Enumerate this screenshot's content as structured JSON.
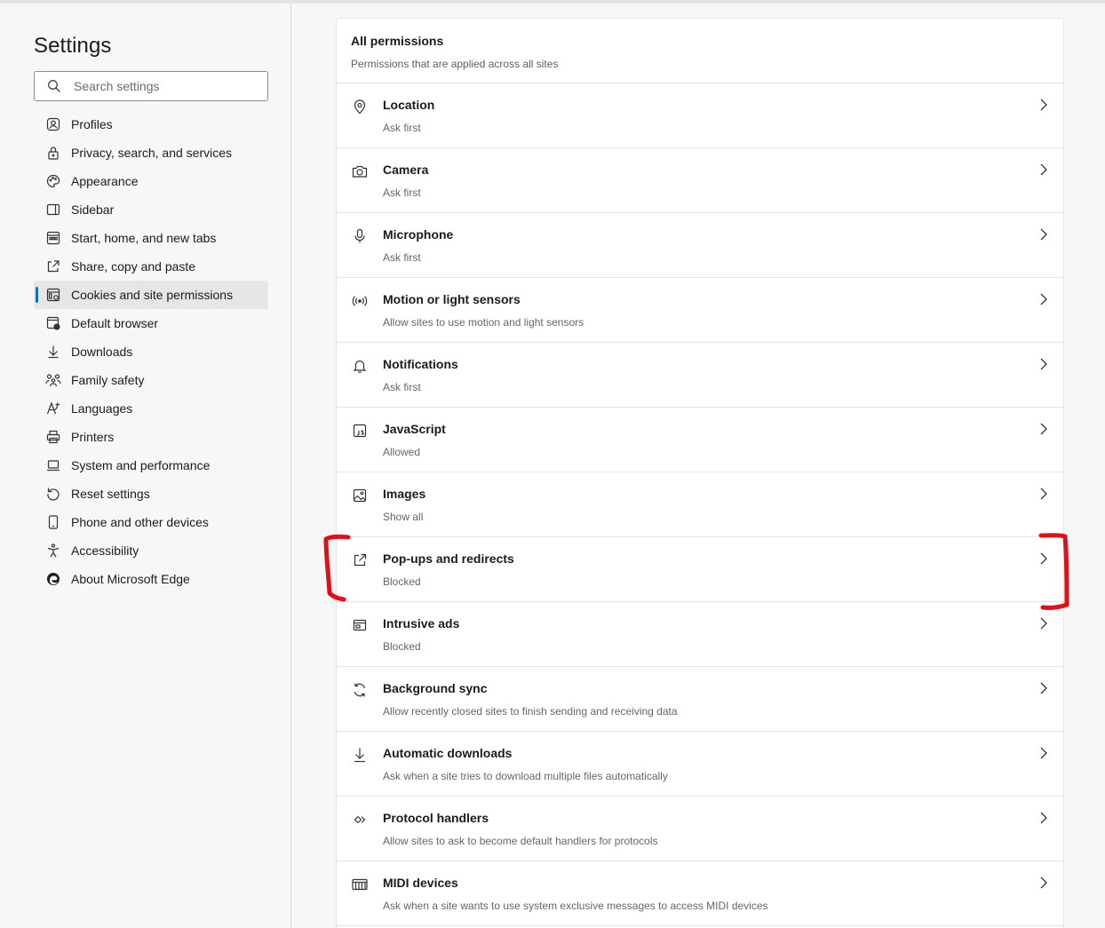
{
  "sidebar": {
    "title": "Settings",
    "search_placeholder": "Search settings",
    "items": [
      {
        "label": "Profiles"
      },
      {
        "label": "Privacy, search, and services"
      },
      {
        "label": "Appearance"
      },
      {
        "label": "Sidebar"
      },
      {
        "label": "Start, home, and new tabs"
      },
      {
        "label": "Share, copy and paste"
      },
      {
        "label": "Cookies and site permissions"
      },
      {
        "label": "Default browser"
      },
      {
        "label": "Downloads"
      },
      {
        "label": "Family safety"
      },
      {
        "label": "Languages"
      },
      {
        "label": "Printers"
      },
      {
        "label": "System and performance"
      },
      {
        "label": "Reset settings"
      },
      {
        "label": "Phone and other devices"
      },
      {
        "label": "Accessibility"
      },
      {
        "label": "About Microsoft Edge"
      }
    ],
    "active_item": "Cookies and site permissions",
    "accent_color": "#0f6cbd"
  },
  "permissions": {
    "title": "All permissions",
    "subtitle": "Permissions that are applied across all sites",
    "items": [
      {
        "title": "Location",
        "status": "Ask first",
        "icon": "location-pin-icon"
      },
      {
        "title": "Camera",
        "status": "Ask first",
        "icon": "camera-icon"
      },
      {
        "title": "Microphone",
        "status": "Ask first",
        "icon": "microphone-icon"
      },
      {
        "title": "Motion or light sensors",
        "status": "Allow sites to use motion and light sensors",
        "icon": "sensor-icon"
      },
      {
        "title": "Notifications",
        "status": "Ask first",
        "icon": "bell-icon"
      },
      {
        "title": "JavaScript",
        "status": "Allowed",
        "icon": "javascript-icon"
      },
      {
        "title": "Images",
        "status": "Show all",
        "icon": "image-icon"
      },
      {
        "title": "Pop-ups and redirects",
        "status": "Blocked",
        "icon": "popup-icon"
      },
      {
        "title": "Intrusive ads",
        "status": "Blocked",
        "icon": "ads-icon"
      },
      {
        "title": "Background sync",
        "status": "Allow recently closed sites to finish sending and receiving data",
        "icon": "sync-icon"
      },
      {
        "title": "Automatic downloads",
        "status": "Ask when a site tries to download multiple files automatically",
        "icon": "download-icon"
      },
      {
        "title": "Protocol handlers",
        "status": "Allow sites to ask to become default handlers for protocols",
        "icon": "protocol-icon"
      },
      {
        "title": "MIDI devices",
        "status": "Ask when a site wants to use system exclusive messages to access MIDI devices",
        "icon": "midi-icon"
      }
    ]
  },
  "annotation": {
    "color": "#e0101a",
    "target": "Pop-ups and redirects"
  }
}
